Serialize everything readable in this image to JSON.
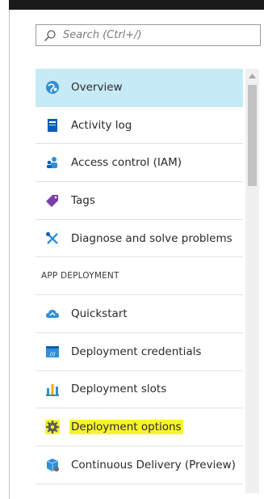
{
  "search": {
    "placeholder": "Search (Ctrl+/)"
  },
  "menu": {
    "items_top": [
      {
        "label": "Overview",
        "icon": "overview-icon"
      },
      {
        "label": "Activity log",
        "icon": "activity-log-icon"
      },
      {
        "label": "Access control (IAM)",
        "icon": "access-control-icon"
      },
      {
        "label": "Tags",
        "icon": "tag-icon"
      },
      {
        "label": "Diagnose and solve problems",
        "icon": "wrench-icon"
      }
    ],
    "section_header": "APP DEPLOYMENT",
    "items_deploy": [
      {
        "label": "Quickstart",
        "icon": "cloud-icon"
      },
      {
        "label": "Deployment credentials",
        "icon": "credentials-icon"
      },
      {
        "label": "Deployment slots",
        "icon": "slots-icon"
      },
      {
        "label": "Deployment options",
        "icon": "gear-icon"
      },
      {
        "label": "Continuous Delivery (Preview)",
        "icon": "continuous-delivery-icon"
      }
    ]
  },
  "colors": {
    "selected_bg": "#c7ebf6",
    "highlight": "#f6f52a",
    "accent_blue": "#0072c6"
  }
}
